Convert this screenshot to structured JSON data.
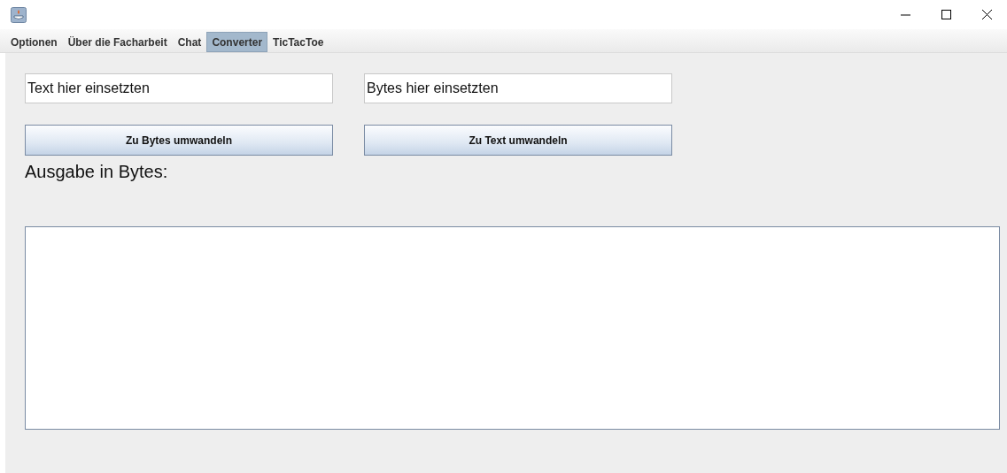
{
  "menu": [
    {
      "label": "Optionen",
      "selected": false
    },
    {
      "label": "Über die Facharbeit",
      "selected": false
    },
    {
      "label": "Chat",
      "selected": false
    },
    {
      "label": "Converter",
      "selected": true
    },
    {
      "label": "TicTacToe",
      "selected": false
    }
  ],
  "text_input": {
    "value": "Text hier einsetzten"
  },
  "bytes_input": {
    "value": "Bytes hier einsetzten"
  },
  "buttons": [
    "Zu Bytes umwandeln",
    "Zu Text umwandeln"
  ],
  "output_label": "Ausgabe in Bytes:"
}
